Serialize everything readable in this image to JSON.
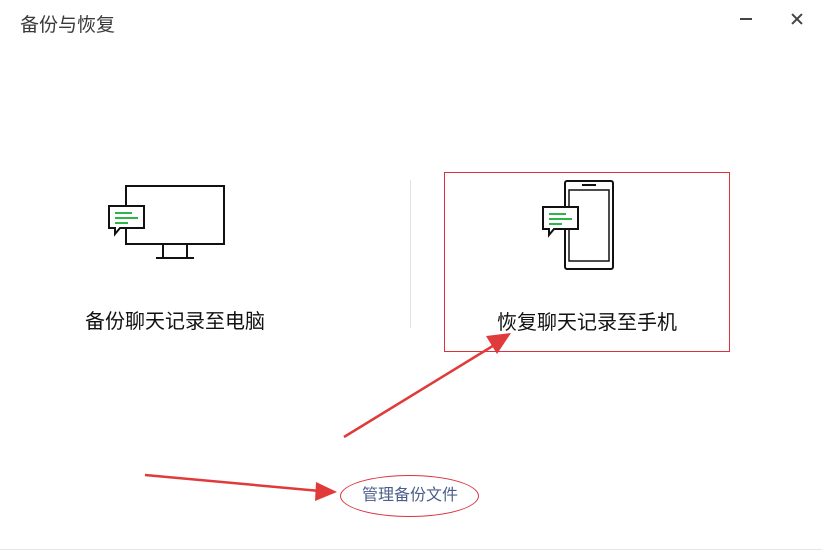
{
  "window": {
    "title": "备份与恢复"
  },
  "options": {
    "backup_label": "备份聊天记录至电脑",
    "restore_label": "恢复聊天记录至手机"
  },
  "footer": {
    "manage_link": "管理备份文件"
  },
  "colors": {
    "accent_green": "#2fb44a",
    "highlight_red": "#d9333f",
    "link_blue": "#4b5e8a"
  },
  "icons": {
    "pc": "monitor-chat-icon",
    "phone": "phone-chat-icon"
  }
}
